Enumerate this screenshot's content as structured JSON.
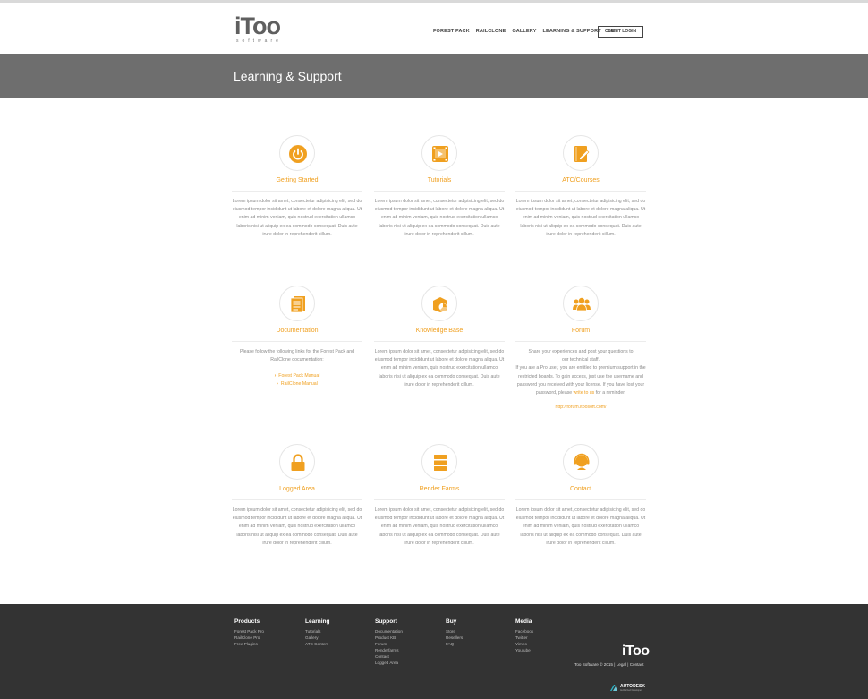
{
  "header": {
    "logo_main": "iToo",
    "logo_sub": "software",
    "nav": [
      "FOREST PACK",
      "RAILCLONE",
      "GALLERY",
      "LEARNING & SUPPORT",
      "BUY"
    ],
    "client_login": "CLIENT LOGIN"
  },
  "page_title": "Learning & Support",
  "accent_color": "#f0a020",
  "cards": [
    {
      "title": "Getting Started",
      "icon": "power-icon",
      "text": "Lorem ipsum dolor sit amet, consectetur adipisicing elit, sed do eiusmod tempor incididunt ut labore et dolore magna aliqua. Ut enim ad minim veniam, quis nostrud exercitation ullamco laboris nisi ut aliquip ex ea commodo consequat. Duis aute irure dolor in reprehenderit cillum."
    },
    {
      "title": "Tutorials",
      "icon": "video-icon",
      "text": "Lorem ipsum dolor sit amet, consectetur adipisicing elit, sed do eiusmod tempor incididunt ut labore et dolore magna aliqua. Ut enim ad minim veniam, quis nostrud exercitation ullamco laboris nisi ut aliquip ex ea commodo consequat. Duis aute irure dolor in reprehenderit cillum."
    },
    {
      "title": "ATC/Courses",
      "icon": "book-pencil-icon",
      "text": "Lorem ipsum dolor sit amet, consectetur adipisicing elit, sed do eiusmod tempor incididunt ut labore et dolore magna aliqua. Ut enim ad minim veniam, quis nostrud exercitation ullamco laboris nisi ut aliquip ex ea commodo consequat. Duis aute irure dolor in reprehenderit cillum."
    },
    {
      "title": "Documentation",
      "icon": "document-icon",
      "text": "Please follow the following links for the Forest Pack and RailClone documentation:",
      "links": [
        "Forest Pack Manual",
        "RailClone Manual"
      ]
    },
    {
      "title": "Knowledge Base",
      "icon": "box-chart-icon",
      "text": "Lorem ipsum dolor sit amet, consectetur adipisicing elit, sed do eiusmod tempor incididunt ut labore et dolore magna aliqua. Ut enim ad minim veniam, quis nostrud exercitation ullamco laboris nisi ut aliquip ex ea commodo consequat. Duis aute irure dolor in reprehenderit cillum."
    },
    {
      "title": "Forum",
      "icon": "users-icon",
      "text_1": "Share your experiences and post your questions to our technical staff.",
      "text_2": "If you are a Pro user, you are entitled to premium support in the restricted boards. To gain access, just use the username and password you received with your license. If you have lost your password, please",
      "text_link": "write to us",
      "text_3": "for a reminder.",
      "url": "http://forum.itoosoft.com/"
    },
    {
      "title": "Logged Area",
      "icon": "lock-icon",
      "text": "Lorem ipsum dolor sit amet, consectetur adipisicing elit, sed do eiusmod tempor incididunt ut labore et dolore magna aliqua. Ut enim ad minim veniam, quis nostrud exercitation ullamco laboris nisi ut aliquip ex ea commodo consequat. Duis aute irure dolor in reprehenderit cillum."
    },
    {
      "title": "Render Farms",
      "icon": "server-icon",
      "text": "Lorem ipsum dolor sit amet, consectetur adipisicing elit, sed do eiusmod tempor incididunt ut labore et dolore magna aliqua. Ut enim ad minim veniam, quis nostrud exercitation ullamco laboris nisi ut aliquip ex ea commodo consequat. Duis aute irure dolor in reprehenderit cillum."
    },
    {
      "title": "Contact",
      "icon": "headset-icon",
      "text": "Lorem ipsum dolor sit amet, consectetur adipisicing elit, sed do eiusmod tempor incididunt ut labore et dolore magna aliqua. Ut enim ad minim veniam, quis nostrud exercitation ullamco laboris nisi ut aliquip ex ea commodo consequat. Duis aute irure dolor in reprehenderit cillum."
    }
  ],
  "footer": {
    "columns": [
      {
        "heading": "Products",
        "items": [
          "Forest Pack Pro",
          "RailClone Pro",
          "Free Plugins"
        ]
      },
      {
        "heading": "Learning",
        "items": [
          "Tutorials",
          "Gallery",
          "ATC Centers"
        ]
      },
      {
        "heading": "Support",
        "items": [
          "Documentation",
          "Product KB",
          "Forum",
          "Renderfarms",
          "Contact",
          "Logged Area"
        ]
      },
      {
        "heading": "Buy",
        "items": [
          "Store",
          "Resellers",
          "FAQ"
        ]
      },
      {
        "heading": "Media",
        "items": [
          "Facebook",
          "Twitter",
          "Vimeo",
          "Youtube"
        ]
      }
    ],
    "logo": "iToo",
    "copyright": "iToo Software © 2015 | Legal | Contact",
    "autodesk": "AUTODESK",
    "autodesk_sub": "Authorized Developer"
  }
}
